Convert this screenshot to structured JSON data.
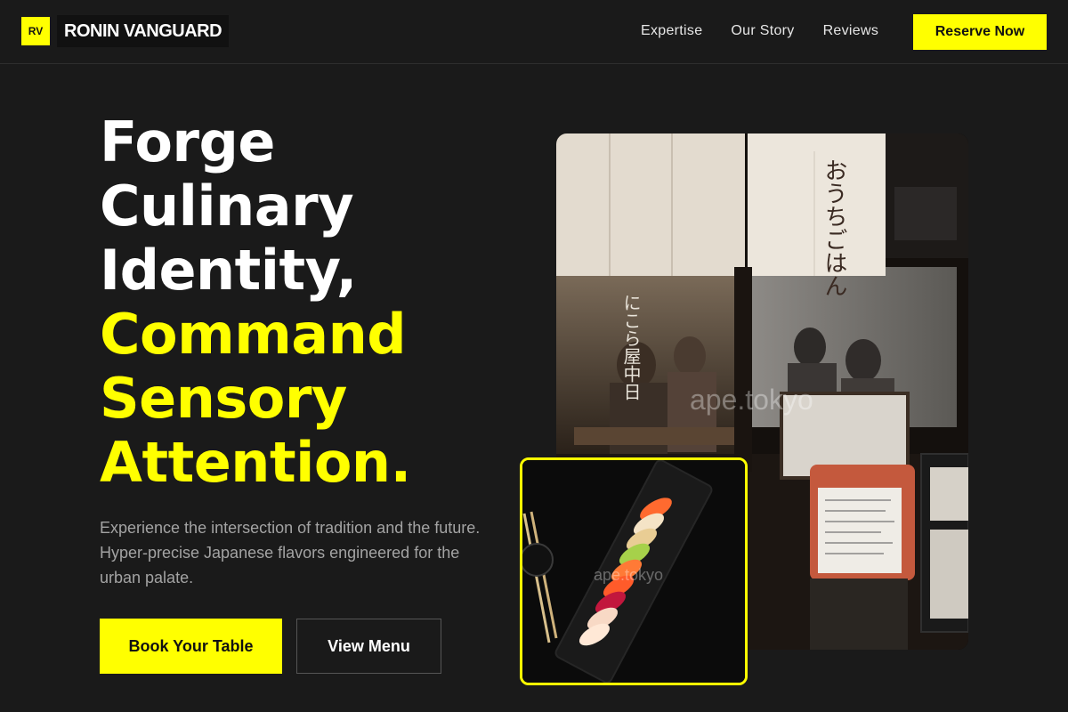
{
  "brand": {
    "mark": "RV",
    "name": "RONIN VANGUARD"
  },
  "nav": {
    "links": [
      "Expertise",
      "Our Story",
      "Reviews"
    ],
    "cta": "Reserve Now"
  },
  "hero": {
    "headline_white": [
      "Forge",
      "Culinary",
      "Identity,"
    ],
    "headline_yellow": [
      "Command",
      "Sensory",
      "Attention."
    ],
    "subtext": "Experience the intersection of tradition and the future. Hyper-precise Japanese flavors engineered for the urban palate.",
    "primary_button": "Book Your Table",
    "secondary_button": "View Menu"
  },
  "images": {
    "restaurant_watermark": "ape.tokyo",
    "restaurant_curtain_text": "おうちごはん",
    "restaurant_window_text": "にこら屋中日",
    "food_watermark": "ape.tokyo"
  },
  "colors": {
    "background": "#1a1a1a",
    "accent": "#ffff00",
    "text": "#ffffff",
    "muted": "#a3a3a3"
  }
}
